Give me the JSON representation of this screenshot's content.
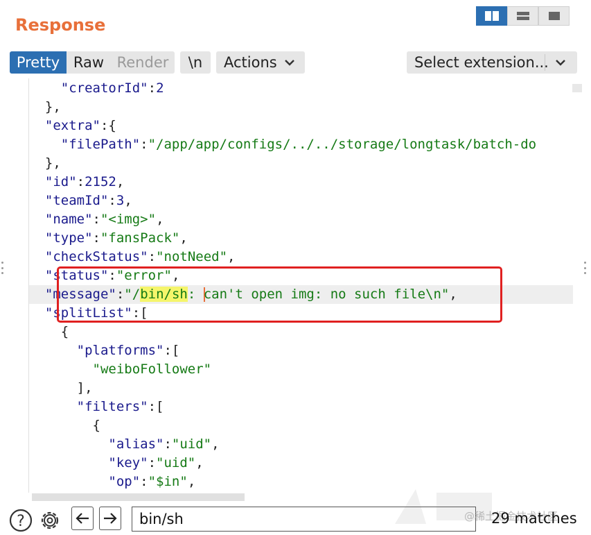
{
  "title": "Response",
  "tabs": [
    {
      "label": "Pretty",
      "state": "active"
    },
    {
      "label": "Raw",
      "state": "normal"
    },
    {
      "label": "Render",
      "state": "disabled"
    }
  ],
  "toolbar": {
    "newline_label": "\\n",
    "actions_label": "Actions",
    "select_extension_label": "Select extension..."
  },
  "code_lines": [
    "    \"creatorId\":2",
    "  },",
    "  \"extra\":{",
    "    \"filePath\":\"/app/app/configs/../../storage/longtask/batch-do",
    "  },",
    "  \"id\":2152,",
    "  \"teamId\":3,",
    "  \"name\":\"<img>\",",
    "  \"type\":\"fansPack\",",
    "  \"checkStatus\":\"notNeed\",",
    "  \"status\":\"error\",",
    "  \"message\":\"/bin/sh: can't open img: no such file\\n\",",
    "  \"splitList\":[",
    "    {",
    "      \"platforms\":[",
    "        \"weiboFollower\"",
    "      ],",
    "      \"filters\":[",
    "        {",
    "          \"alias\":\"uid\",",
    "          \"key\":\"uid\",",
    "          \"op\":\"$in\","
  ],
  "search": {
    "value": "bin/sh",
    "match_count": "29 matches"
  },
  "watermark": "@稀土掘金技术社区",
  "colors": {
    "accent": "#e8703a",
    "tab_active": "#2c6fb2",
    "highlight_box": "#e02020",
    "match_highlight": "#f5f56b"
  }
}
